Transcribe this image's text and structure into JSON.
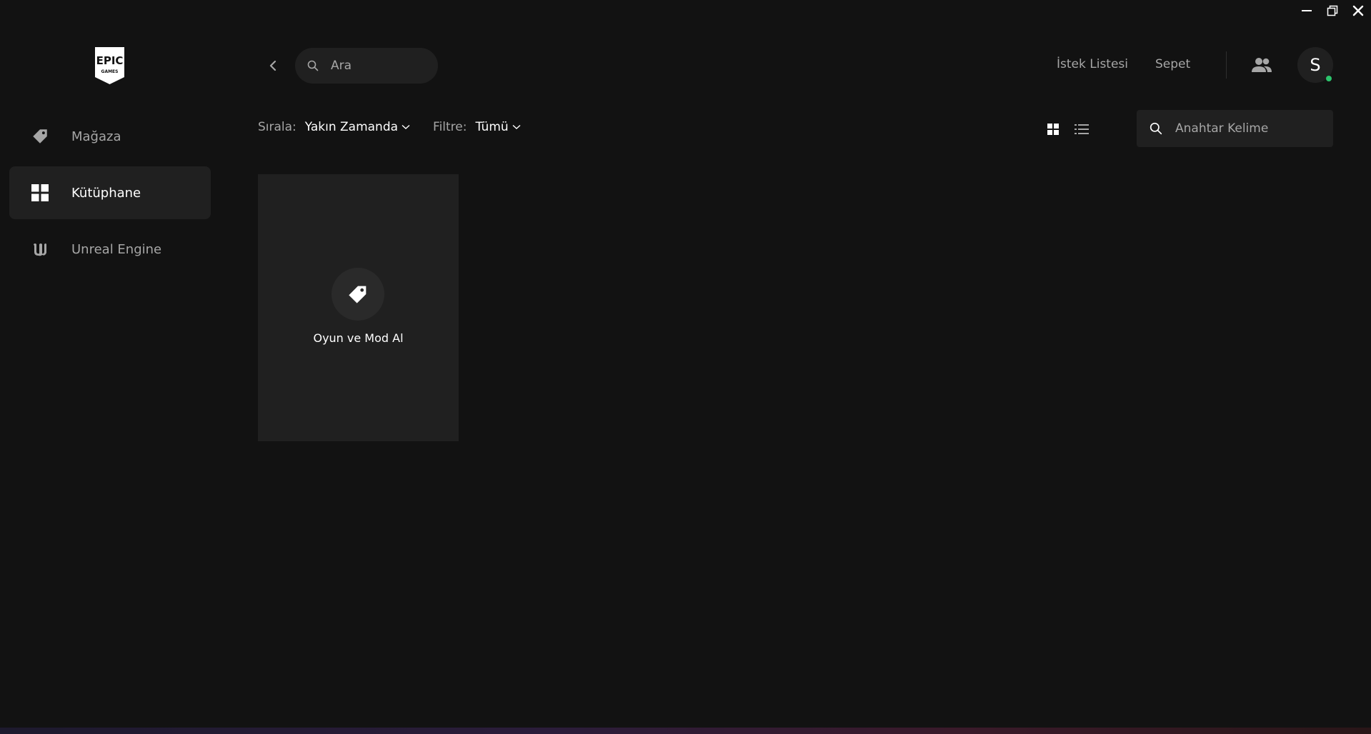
{
  "window": {
    "controls": [
      "minimize-icon",
      "restore-icon",
      "close-icon"
    ]
  },
  "sidebar": {
    "logo_text_top": "EPIC",
    "logo_text_bottom": "GAMES",
    "items": [
      {
        "label": "Mağaza",
        "icon": "tag-icon",
        "active": false
      },
      {
        "label": "Kütüphane",
        "icon": "grid-icon",
        "active": true
      },
      {
        "label": "Unreal Engine",
        "icon": "unreal-icon",
        "active": false
      }
    ]
  },
  "header": {
    "search_placeholder": "Ara",
    "wishlist_label": "İstek Listesi",
    "cart_label": "Sepet",
    "avatar_initial": "S",
    "status_color": "#2cc46c"
  },
  "filters": {
    "sort_label": "Sırala:",
    "sort_value": "Yakın Zamanda",
    "filter_label": "Filtre:",
    "filter_value": "Tümü",
    "keyword_placeholder": "Anahtar Kelime"
  },
  "library": {
    "cards": [
      {
        "label": "Oyun ve Mod Al",
        "icon": "tag-icon"
      }
    ]
  },
  "colors": {
    "background": "#121212",
    "panel": "#202020",
    "muted_text": "#a6a6a6"
  }
}
